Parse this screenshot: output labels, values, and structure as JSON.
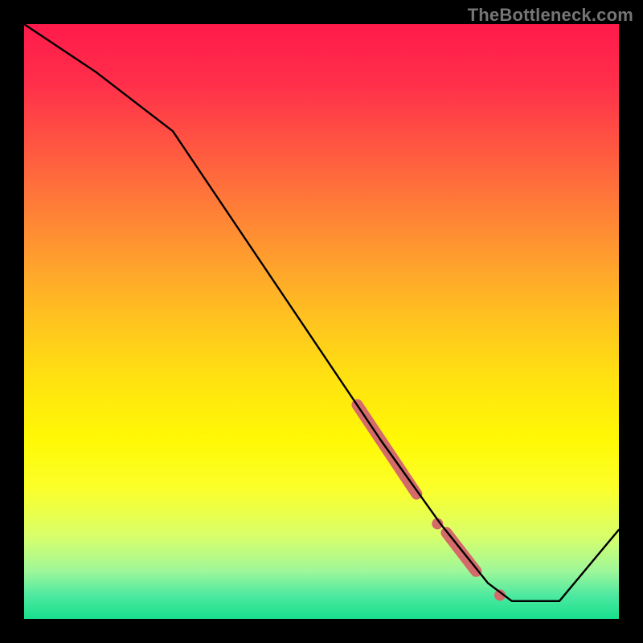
{
  "watermark": "TheBottleneck.com",
  "colors": {
    "frame": "#000000",
    "gradient_stops": [
      {
        "offset": 0.0,
        "color": "#ff1a4b"
      },
      {
        "offset": 0.1,
        "color": "#ff2f4a"
      },
      {
        "offset": 0.2,
        "color": "#ff5442"
      },
      {
        "offset": 0.3,
        "color": "#ff7a38"
      },
      {
        "offset": 0.4,
        "color": "#ffa02d"
      },
      {
        "offset": 0.5,
        "color": "#ffc41f"
      },
      {
        "offset": 0.6,
        "color": "#ffe310"
      },
      {
        "offset": 0.7,
        "color": "#fff905"
      },
      {
        "offset": 0.78,
        "color": "#fbff2a"
      },
      {
        "offset": 0.86,
        "color": "#d9ff6a"
      },
      {
        "offset": 0.92,
        "color": "#9ef79a"
      },
      {
        "offset": 0.96,
        "color": "#4ee9a0"
      },
      {
        "offset": 1.0,
        "color": "#18df8d"
      }
    ],
    "line": "#000000",
    "marker": "#d46a6a"
  },
  "chart_data": {
    "type": "line",
    "title": "",
    "xlabel": "",
    "ylabel": "",
    "xlim": [
      0,
      100
    ],
    "ylim": [
      0,
      100
    ],
    "grid": false,
    "series": [
      {
        "name": "bottleneck-curve",
        "x": [
          0,
          12,
          25,
          60,
          70,
          78,
          82,
          90,
          100
        ],
        "y": [
          100,
          92,
          82,
          30,
          16,
          6,
          3,
          3,
          15
        ]
      }
    ],
    "markers": [
      {
        "name": "highlight-segment-upper",
        "type": "segment",
        "x": [
          56,
          66
        ],
        "y": [
          36,
          21
        ]
      },
      {
        "name": "highlight-dot-a",
        "type": "dot",
        "x": 69.5,
        "y": 16
      },
      {
        "name": "highlight-segment-mid",
        "type": "segment",
        "x": [
          71,
          76
        ],
        "y": [
          14.5,
          8
        ]
      },
      {
        "name": "highlight-dot-b",
        "type": "dot",
        "x": 80,
        "y": 4
      }
    ]
  }
}
